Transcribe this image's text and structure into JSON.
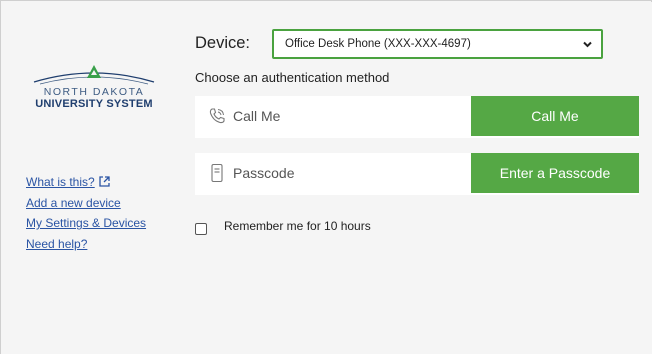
{
  "logo": {
    "line1": "NORTH DAKOTA",
    "line2": "UNIVERSITY SYSTEM",
    "colors": {
      "accent": "#3aa04a",
      "navy": "#1f3e6e"
    }
  },
  "sidebar": {
    "links": [
      {
        "label": "What is this?",
        "icon": "external-link-icon"
      },
      {
        "label": "Add a new device"
      },
      {
        "label": "My Settings & Devices"
      },
      {
        "label": "Need help?"
      }
    ]
  },
  "main": {
    "device_label": "Device:",
    "device_select": {
      "value": "Office Desk Phone (XXX-XXX-4697)",
      "icon": "chevron-down-icon"
    },
    "choose_text": "Choose an authentication method",
    "methods": [
      {
        "label": "Call Me",
        "button": "Call Me",
        "icon": "phone-icon"
      },
      {
        "label": "Passcode",
        "button": "Enter a Passcode",
        "icon": "passcode-token-icon"
      }
    ],
    "remember": {
      "label": "Remember me for 10 hours",
      "checked": false
    }
  },
  "colors": {
    "button_green": "#55a845",
    "select_border": "#4aa23f",
    "link_blue": "#2a54a4",
    "panel_bg": "#f5f5f5"
  }
}
